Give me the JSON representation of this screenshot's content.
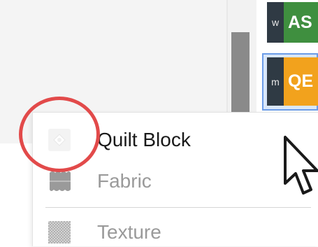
{
  "tiles": [
    {
      "small": "w",
      "big": "AS",
      "color": "#3f8f3f"
    },
    {
      "small": "m",
      "big": "QE",
      "color": "#f2a21d"
    }
  ],
  "menu": {
    "items": [
      {
        "label": "Quilt Block",
        "icon": "quilt-block-icon",
        "enabled": true
      },
      {
        "label": "Fabric",
        "icon": "fabric-icon",
        "enabled": false
      },
      {
        "label": "Texture",
        "icon": "texture-icon",
        "enabled": false
      }
    ]
  },
  "colors": {
    "annotation": "#e24a4a",
    "selection_border": "#6b9ce8"
  }
}
